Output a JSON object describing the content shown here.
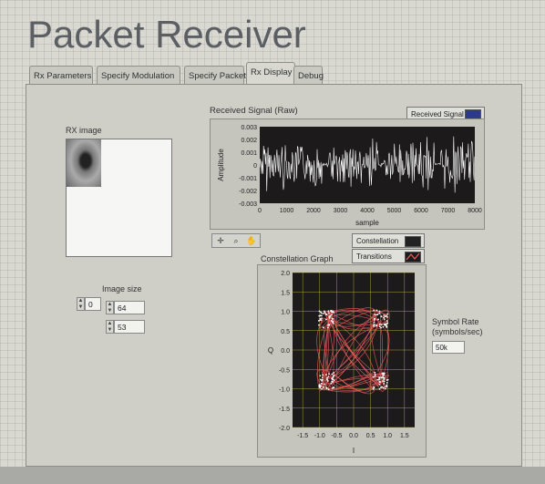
{
  "app": {
    "title": "Packet Receiver"
  },
  "tabs": [
    {
      "label": "Rx Parameters"
    },
    {
      "label": "Specify Modulation"
    },
    {
      "label": "Specify Packet"
    },
    {
      "label": "Rx Display"
    },
    {
      "label": "Debug"
    }
  ],
  "active_tab": "Rx Display",
  "rx_image": {
    "label": "RX image"
  },
  "image_size": {
    "label": "Image size",
    "index_value": "0",
    "width_value": "64",
    "height_value": "53"
  },
  "received_signal": {
    "title": "Received Signal (Raw)",
    "legend_label": "Received Signal",
    "y_axis_label": "Amplitude",
    "x_axis_label": "sample",
    "y_ticks": [
      "0.003",
      "0.002",
      "0.001",
      "0",
      "-0.001",
      "-0.002",
      "-0.003"
    ],
    "x_ticks": [
      "0",
      "1000",
      "2000",
      "3000",
      "4000",
      "5000",
      "6000",
      "7000",
      "8000"
    ]
  },
  "constellation": {
    "title": "Constellation Graph",
    "legend_constellation": "Constellation",
    "legend_transitions": "Transitions",
    "y_axis_label": "Q",
    "x_axis_label": "I",
    "y_ticks": [
      "2.0",
      "1.5",
      "1.0",
      "0.5",
      "0.0",
      "-0.5",
      "-1.0",
      "-1.5",
      "-2.0"
    ],
    "x_ticks": [
      "-1.5",
      "-1.0",
      "-0.5",
      "0.0",
      "0.5",
      "1.0",
      "1.5"
    ]
  },
  "symbol_rate": {
    "label_line1": "Symbol Rate",
    "label_line2": "(symbols/sec)",
    "value": "50k"
  },
  "colors": {
    "panel": "#cfcfc8",
    "plot_background": "#1c1a1a",
    "signal_trace": "#ffffff",
    "constellation_points": "#ffffff",
    "transitions": "#e55a5a",
    "grid": "#d8d84a"
  },
  "toolbar": {
    "icons": [
      "crosshair-icon",
      "zoom-icon",
      "pan-hand-icon"
    ]
  }
}
